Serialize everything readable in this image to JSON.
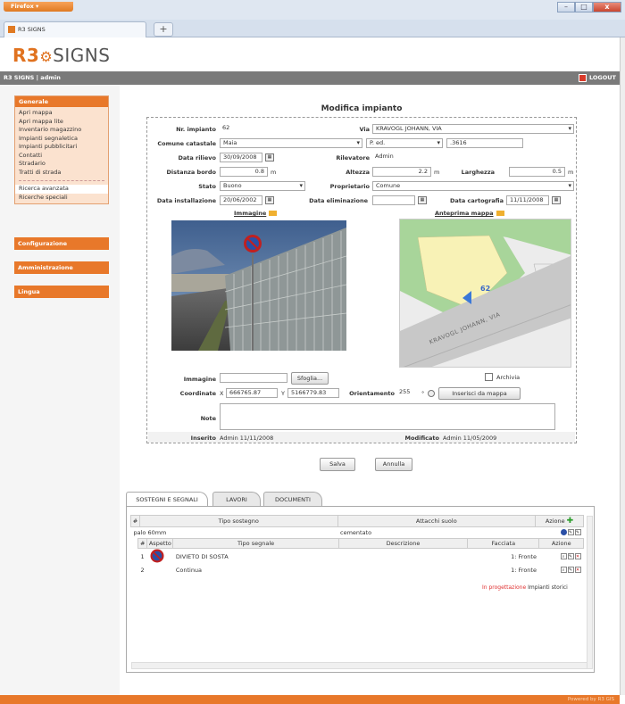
{
  "browser": {
    "menu_button": "Firefox",
    "tab_title": "R3 SIGNS",
    "new_tab": "+",
    "win_min": "–",
    "win_max": "□",
    "win_close": "x"
  },
  "app": {
    "logo_r3": "R3",
    "logo_signs": "SIGNS",
    "user_bar": "R3 SIGNS | admin",
    "logout": "LOGOUT",
    "footer": "Powered by R3 GIS"
  },
  "sidebar": {
    "general_title": "Generale",
    "items": [
      "Apri mappa",
      "Apri mappa lite",
      "Inventario magazzino",
      "Impianti segnaletica",
      "Impianti pubblicitari",
      "Contatti",
      "Stradario",
      "Tratti di strada"
    ],
    "search_items": [
      "Ricerca avanzata",
      "Ricerche speciali"
    ],
    "config": "Configurazione",
    "admin": "Amministrazione",
    "lang": "Lingua"
  },
  "form": {
    "title": "Modifica impianto",
    "nr_label": "Nr. impianto",
    "nr_value": "62",
    "via_label": "Via",
    "via_value": "KRAVOGL JOHANN, VIA",
    "comune_label": "Comune catastale",
    "comune_value": "Maia",
    "ped_value": "P. ed.",
    "ped_num": ".3616",
    "data_rilievo_label": "Data rilievo",
    "data_rilievo_value": "30/09/2008",
    "rilevatore_label": "Rilevatore",
    "rilevatore_value": "Admin",
    "distanza_label": "Distanza bordo",
    "distanza_value": "0.8",
    "altezza_label": "Altezza",
    "altezza_value": "2.2",
    "larghezza_label": "Larghezza",
    "larghezza_value": "0.5",
    "unit_m": "m",
    "stato_label": "Stato",
    "stato_value": "Buono",
    "proprietario_label": "Proprietario",
    "proprietario_value": "Comune",
    "data_inst_label": "Data installazione",
    "data_inst_value": "20/06/2002",
    "data_elim_label": "Data eliminazione",
    "data_elim_value": "",
    "data_carto_label": "Data cartografia",
    "data_carto_value": "11/11/2008",
    "immagine_title": "Immagine",
    "anteprima_title": "Anteprima mappa",
    "map_label_num": "62",
    "map_street": "KRAVOGL JOHANN, VIA",
    "immagine_label": "Immagine",
    "immagine_value": "",
    "sfoglia": "Sfoglia...",
    "archivia": "Archivia",
    "coord_label": "Coordinate",
    "coord_x_prefix": "X",
    "coord_x": "666765.87",
    "coord_y_prefix": "Y",
    "coord_y": "5166779.83",
    "orient_label": "Orientamento",
    "orient_value": "255",
    "orient_unit": "°",
    "inserisci": "Inserisci da mappa",
    "note_label": "Note",
    "note_value": "",
    "inserito_label": "Inserito",
    "inserito_value": "Admin 11/11/2008",
    "modificato_label": "Modificato",
    "modificato_value": "Admin 11/05/2009",
    "salva": "Salva",
    "annulla": "Annulla"
  },
  "tabs": [
    "SOSTEGNI E SEGNALI",
    "LAVORI",
    "DOCUMENTI"
  ],
  "grid": {
    "h_hash": "#",
    "h_tipo_sostegno": "Tipo sostegno",
    "h_attacchi": "Attacchi suolo",
    "h_azione": "Azione",
    "row_tipo": "palo 60mm",
    "row_attacchi": "cementato",
    "s_hash": "#",
    "s_aspetto": "Aspetto",
    "s_tipo_segnale": "Tipo segnale",
    "s_descrizione": "Descrizione",
    "s_facciata": "Facciata",
    "s_azione": "Azione",
    "signs": [
      {
        "n": "1",
        "tipo": "DIVIETO DI SOSTA",
        "descr": "",
        "facciata": "1: Fronte"
      },
      {
        "n": "2",
        "tipo": "Continua",
        "descr": "",
        "facciata": "1: Fronte"
      }
    ],
    "in_progettazione": "In progettazione",
    "impianti_storici": "Impianti storici"
  },
  "colors": {
    "accent": "#e8782a",
    "topbar": "#7a7a7a",
    "danger": "#d93a2a"
  }
}
